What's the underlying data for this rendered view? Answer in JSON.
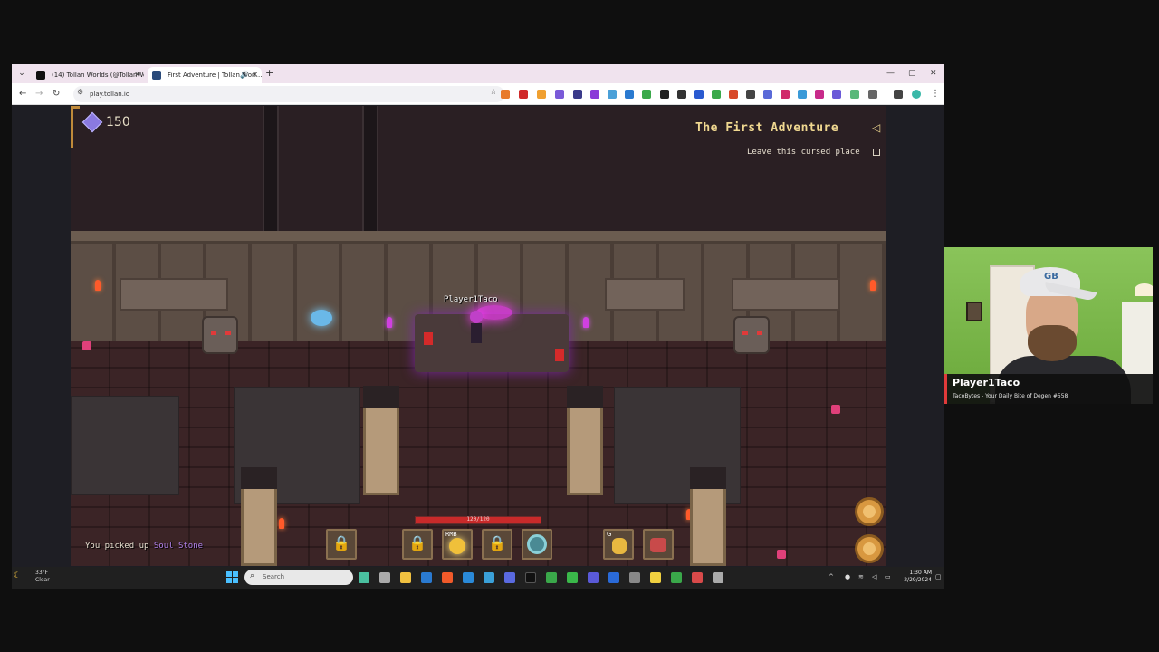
{
  "browser": {
    "tabs": [
      {
        "title": "(14) Tollan Worlds (@TollanWo...",
        "active": false
      },
      {
        "title": "First Adventure | Tollan Worl...",
        "active": true
      }
    ],
    "new_tab": "+",
    "url": "play.tollan.io"
  },
  "game": {
    "gem_count": "150",
    "quest": {
      "title": "The First Adventure",
      "objective": "Leave this cursed place"
    },
    "player_name": "Player1Taco",
    "hp": {
      "current": 120,
      "max": 120,
      "text": "120/120"
    },
    "hotbar": [
      {
        "type": "locked"
      },
      {
        "type": "locked"
      },
      {
        "type": "fireball",
        "label": "RMB"
      },
      {
        "type": "locked"
      },
      {
        "type": "swirl"
      }
    ],
    "consumables": [
      {
        "type": "potion",
        "key": "G"
      },
      {
        "type": "meat",
        "key": ""
      }
    ],
    "pickup": {
      "prefix": "You picked up",
      "item": "Soul Stone"
    },
    "colors": {
      "hp": "#c82a2a",
      "quest_title": "#f0d890",
      "pickup_item": "#b080e8"
    }
  },
  "taskbar": {
    "weather_temp": "33°F",
    "weather_cond": "Clear",
    "search_placeholder": "Search",
    "time": "1:30 AM",
    "date": "2/29/2024"
  },
  "webcam": {
    "cap_logo": "GB",
    "name": "Player1Taco",
    "subtitle": "TacoBytes - Your Daily Bite of Degen #558"
  }
}
